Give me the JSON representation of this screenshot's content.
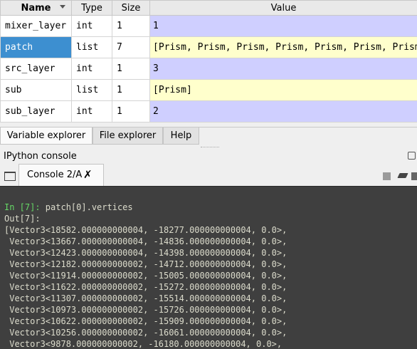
{
  "variable_explorer": {
    "columns": {
      "name": "Name",
      "type": "Type",
      "size": "Size",
      "value": "Value"
    },
    "rows": [
      {
        "name": "mixer_layer",
        "type": "int",
        "size": "1",
        "value": "1"
      },
      {
        "name": "patch",
        "type": "list",
        "size": "7",
        "value": "[Prism, Prism, Prism, Prism, Prism, Prism, Prism]"
      },
      {
        "name": "src_layer",
        "type": "int",
        "size": "1",
        "value": "3"
      },
      {
        "name": "sub",
        "type": "list",
        "size": "1",
        "value": "[Prism]"
      },
      {
        "name": "sub_layer",
        "type": "int",
        "size": "1",
        "value": "2"
      }
    ]
  },
  "tabs": {
    "variable_explorer": "Variable explorer",
    "file_explorer": "File explorer",
    "help": "Help"
  },
  "ipython": {
    "title": "IPython console",
    "console_tab": "Console 2/A"
  },
  "console": {
    "in_prompt": "In [7]:",
    "command": " patch[0].vertices",
    "out_prompt": "Out[7]:",
    "output_lines": [
      "[Vector3<18582.000000000004, -18277.000000000004, 0.0>,",
      " Vector3<13667.000000000004, -14836.000000000004, 0.0>,",
      " Vector3<12423.000000000004, -14398.000000000004, 0.0>,",
      " Vector3<12182.000000000002, -14712.000000000004, 0.0>,",
      " Vector3<11914.000000000002, -15005.000000000004, 0.0>,",
      " Vector3<11622.000000000002, -15272.000000000004, 0.0>,",
      " Vector3<11307.000000000002, -15514.000000000004, 0.0>,",
      " Vector3<10973.000000000002, -15726.000000000004, 0.0>,",
      " Vector3<10622.000000000002, -15909.000000000004, 0.0>,",
      " Vector3<10256.000000000002, -16061.000000000004, 0.0>,",
      " Vector3<9878.000000000002, -16180.000000000004, 0.0>,"
    ]
  },
  "colors": {
    "selected_row": "#3d8fd0",
    "int_value_bg": "#cfcfff",
    "list_value_bg": "#ffffcc",
    "console_bg": "#3f3f3f",
    "in_prompt": "#66d866",
    "out_prompt": "#d42d2d"
  }
}
